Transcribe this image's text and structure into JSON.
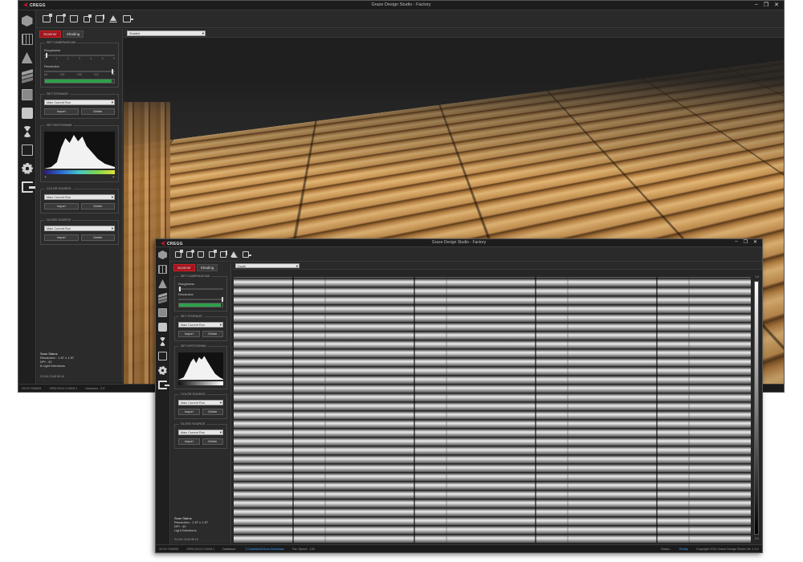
{
  "back_window": {
    "title": "Graze Design Studio - Factory",
    "logo": "CREGG",
    "tabs": [
      "Scanner",
      "Shading"
    ],
    "view_select": "Shaded",
    "groups": {
      "camera_settings": "SET CAMERA/SCAN",
      "roughness": "Roughness",
      "resolution": "Resolution",
      "roughness_ticks": [
        "0",
        "1",
        "2",
        "3",
        "4",
        "5",
        "6"
      ],
      "resolution_ticks": [
        "64",
        "128",
        "256",
        "512",
        "1K"
      ],
      "set_storage": "SET STORAGE",
      "storage_select": "Main Current Run",
      "import": "Import",
      "delete": "Delete",
      "set_histogram": "SET HISTOGRAM",
      "color_source": "COLOR SOURCE",
      "color_select": "Main Current Run",
      "gloss_source": "GLOSS SOURCE",
      "gloss_select": "Main Current Run"
    },
    "status_info": {
      "label": "Scan Status",
      "resolution": "Resolution : 1.57 x 1.57",
      "dpi": "DPI : 40",
      "lights": "8 Light Directions",
      "scan_id": "SCAN 2048 8K16"
    },
    "statusbar": [
      "29.29.7008/05",
      "VRSC/0/12.0.9003.1",
      "Unknown : 2.0"
    ],
    "progress": 0.97
  },
  "front_window": {
    "title": "Graze Design Studio - Factory",
    "logo": "CREGG",
    "tabs": [
      "Scanner",
      "Shading"
    ],
    "view_select": "Depth",
    "groups": {
      "camera_settings": "SET CAMERA/SCAN",
      "roughness": "Roughness",
      "resolution": "Resolution",
      "set_storage": "SET STORAGE",
      "storage_select": "Main Current Run",
      "import": "Import",
      "delete": "Delete",
      "set_histogram": "SET HISTOGRAM",
      "color_source": "COLOR SOURCE",
      "color_select": "Main Current Run",
      "gloss_source": "GLOSS SOURCE",
      "gloss_select": "Main Current Run"
    },
    "status_info": {
      "label": "Scan Status",
      "resolution": "Resolution : 1.57 x 1.57",
      "dpi": "DPI : 40",
      "lights": "Light Directions",
      "scan_id": "SCAN 2048 8K16"
    },
    "statusbar": {
      "left": "29.29.7008/05",
      "mid": "VRSC/0/12.0.9003.1",
      "path_label": "Database :",
      "path": "C:\\Data\\Bulk\\Scan\\Database",
      "speed": "Fan Speed : 100",
      "status_label": "Status :",
      "status_value": "Ready",
      "copyright": "Copyright 2016 Graze Design Studio Ver 1.0.1"
    },
    "depth_top": "1.0",
    "depth_bottom": "0.0",
    "progress": 0.97
  },
  "colors": {
    "accent_red": "#a3151e",
    "progress_green": "#2fa04a",
    "status_blue": "#3fa2ff"
  }
}
